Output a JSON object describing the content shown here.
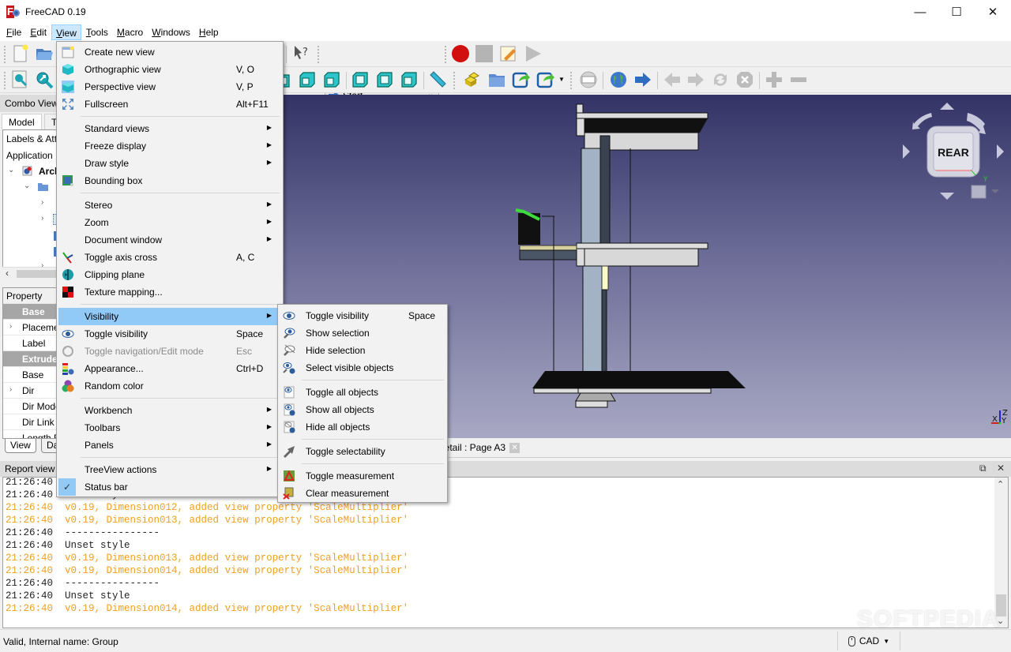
{
  "window": {
    "title": "FreeCAD 0.19",
    "controls": {
      "minimize": "—",
      "maximize": "☐",
      "close": "✕"
    }
  },
  "menubar": {
    "items": [
      {
        "label": "File",
        "mnemonic": "F"
      },
      {
        "label": "Edit",
        "mnemonic": "E"
      },
      {
        "label": "View",
        "mnemonic": "V",
        "active": true
      },
      {
        "label": "Tools",
        "mnemonic": "T"
      },
      {
        "label": "Macro",
        "mnemonic": "M"
      },
      {
        "label": "Windows",
        "mnemonic": "W"
      },
      {
        "label": "Help",
        "mnemonic": "H"
      }
    ]
  },
  "toolbar": {
    "workbench_selector": "Start",
    "icons_row1": [
      "new-document-icon",
      "open-document-icon",
      "whats-this-icon",
      "macro-record-icon",
      "macro-stop-icon",
      "macro-edit-icon",
      "macro-execute-icon"
    ],
    "icons_row2": [
      "fit-all-icon",
      "fit-selection-icon",
      "view-isometric-icon",
      "view-front-icon",
      "view-top-icon",
      "view-right-icon",
      "view-rear-icon",
      "view-bottom-icon",
      "view-left-icon",
      "measure-distance-icon",
      "part-icon",
      "group-icon",
      "link-icon",
      "link-actions-icon",
      "web-placeholder-icon",
      "web-home-icon",
      "web-go-icon",
      "web-back-icon",
      "web-forward-icon",
      "web-refresh-icon",
      "web-stop-icon",
      "zoom-in-icon",
      "zoom-out-icon"
    ]
  },
  "combo_view": {
    "title": "Combo View",
    "tabs": [
      "Model",
      "Tasks"
    ],
    "tree": {
      "header": "Labels & Attributes",
      "section": "Application",
      "root": "Arch"
    },
    "properties": {
      "header": "Property",
      "rows": [
        {
          "label": "Base",
          "group": true
        },
        {
          "label": "Placement",
          "expandable": true
        },
        {
          "label": "Label"
        },
        {
          "label": "Extrude",
          "group": true
        },
        {
          "label": "Base"
        },
        {
          "label": "Dir",
          "expandable": true
        },
        {
          "label": "Dir Mode"
        },
        {
          "label": "Dir Link"
        },
        {
          "label": "Length Fwd"
        }
      ]
    },
    "bottom_tabs": [
      "View",
      "Data"
    ]
  },
  "view_menu": {
    "items": [
      {
        "type": "item",
        "label": "Create new view",
        "icon": "create-view-icon"
      },
      {
        "type": "item",
        "label": "Orthographic view",
        "shortcut": "V, O",
        "icon": "orthographic-icon"
      },
      {
        "type": "item",
        "label": "Perspective view",
        "shortcut": "V, P",
        "icon": "perspective-icon",
        "checked": true
      },
      {
        "type": "item",
        "label": "Fullscreen",
        "shortcut": "Alt+F11",
        "icon": "fullscreen-icon"
      },
      {
        "type": "sep"
      },
      {
        "type": "item",
        "label": "Standard views",
        "submenu": true
      },
      {
        "type": "item",
        "label": "Freeze display",
        "submenu": true
      },
      {
        "type": "item",
        "label": "Draw style",
        "submenu": true
      },
      {
        "type": "item",
        "label": "Bounding box",
        "icon": "bounding-box-icon"
      },
      {
        "type": "sep"
      },
      {
        "type": "item",
        "label": "Stereo",
        "submenu": true
      },
      {
        "type": "item",
        "label": "Zoom",
        "submenu": true
      },
      {
        "type": "item",
        "label": "Document window",
        "submenu": true
      },
      {
        "type": "item",
        "label": "Toggle axis cross",
        "shortcut": "A, C",
        "icon": "axis-cross-icon"
      },
      {
        "type": "item",
        "label": "Clipping plane",
        "icon": "clipping-plane-icon"
      },
      {
        "type": "item",
        "label": "Texture mapping...",
        "icon": "texture-mapping-icon"
      },
      {
        "type": "sep"
      },
      {
        "type": "item",
        "label": "Visibility",
        "submenu": true,
        "highlighted": true
      },
      {
        "type": "item",
        "label": "Toggle visibility",
        "shortcut": "Space",
        "icon": "eye-icon"
      },
      {
        "type": "item",
        "label": "Toggle navigation/Edit mode",
        "shortcut": "Esc",
        "icon": "edit-mode-icon",
        "disabled": true
      },
      {
        "type": "item",
        "label": "Appearance...",
        "shortcut": "Ctrl+D",
        "icon": "appearance-icon"
      },
      {
        "type": "item",
        "label": "Random color",
        "icon": "random-color-icon"
      },
      {
        "type": "sep"
      },
      {
        "type": "item",
        "label": "Workbench",
        "submenu": true
      },
      {
        "type": "item",
        "label": "Toolbars",
        "submenu": true
      },
      {
        "type": "item",
        "label": "Panels",
        "submenu": true
      },
      {
        "type": "sep"
      },
      {
        "type": "item",
        "label": "TreeView actions",
        "submenu": true
      },
      {
        "type": "item",
        "label": "Status bar",
        "checkmark": true
      }
    ]
  },
  "visibility_menu": {
    "items": [
      {
        "type": "item",
        "label": "Toggle visibility",
        "shortcut": "Space",
        "icon": "eye-icon"
      },
      {
        "type": "item",
        "label": "Show selection",
        "icon": "show-selection-icon"
      },
      {
        "type": "item",
        "label": "Hide selection",
        "icon": "hide-selection-icon"
      },
      {
        "type": "item",
        "label": "Select visible objects",
        "icon": "select-visible-icon"
      },
      {
        "type": "sep"
      },
      {
        "type": "item",
        "label": "Toggle all objects",
        "icon": "toggle-all-icon"
      },
      {
        "type": "item",
        "label": "Show all objects",
        "icon": "show-all-icon"
      },
      {
        "type": "item",
        "label": "Hide all objects",
        "icon": "hide-all-icon"
      },
      {
        "type": "sep"
      },
      {
        "type": "item",
        "label": "Toggle selectability",
        "icon": "selectability-icon"
      },
      {
        "type": "sep"
      },
      {
        "type": "item",
        "label": "Toggle measurement",
        "icon": "toggle-measurement-icon"
      },
      {
        "type": "item",
        "label": "Clear measurement",
        "icon": "clear-measurement-icon"
      }
    ]
  },
  "viewport": {
    "navcube_face": "REAR",
    "axis_labels": {
      "x": "X",
      "y": "Y",
      "z": "Z"
    },
    "doc_tab": "Detail : Page A3"
  },
  "report_view": {
    "title": "Report view",
    "lines": [
      {
        "time": "21:26:40",
        "text": "----------------",
        "level": "norm"
      },
      {
        "time": "21:26:40",
        "text": "Unset style",
        "level": "norm"
      },
      {
        "time": "21:26:40",
        "text": "v0.19, Dimension012, added view property 'ScaleMultiplier'",
        "level": "warn"
      },
      {
        "time": "21:26:40",
        "text": "v0.19, Dimension013, added view property 'ScaleMultiplier'",
        "level": "warn"
      },
      {
        "time": "21:26:40",
        "text": "----------------",
        "level": "norm"
      },
      {
        "time": "21:26:40",
        "text": "Unset style",
        "level": "norm"
      },
      {
        "time": "21:26:40",
        "text": "v0.19, Dimension013, added view property 'ScaleMultiplier'",
        "level": "warn"
      },
      {
        "time": "21:26:40",
        "text": "v0.19, Dimension014, added view property 'ScaleMultiplier'",
        "level": "warn"
      },
      {
        "time": "21:26:40",
        "text": "----------------",
        "level": "norm"
      },
      {
        "time": "21:26:40",
        "text": "Unset style",
        "level": "norm"
      },
      {
        "time": "21:26:40",
        "text": "v0.19, Dimension014, added view property 'ScaleMultiplier'",
        "level": "warn"
      }
    ]
  },
  "statusbar": {
    "message": "Valid, Internal name: Group",
    "navigation_style": "CAD"
  },
  "watermark": "SOFTPEDIA",
  "colors": {
    "menu_highlight": "#91c9f7",
    "log_warning": "#f0a020",
    "viewport_top": "#333366",
    "viewport_bottom": "#a8a8c4"
  }
}
